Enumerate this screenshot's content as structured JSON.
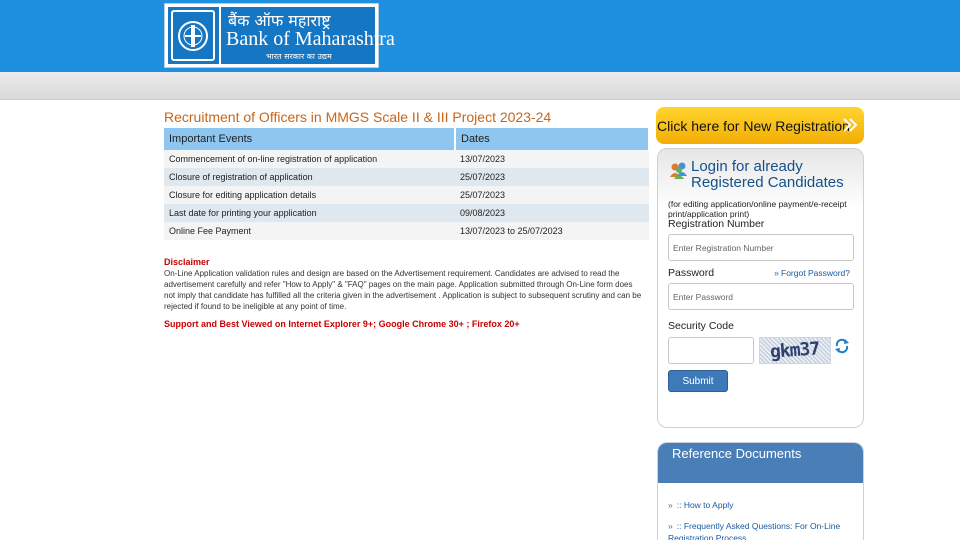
{
  "header": {
    "logo_hindi": "बैंक ऑफ महाराष्ट्र",
    "logo_english": "Bank of Maharashtra",
    "logo_tagline": "भारत सरकार का उद्यम",
    "brand_color": "#1f90e0"
  },
  "main": {
    "title": "Recruitment of Officers in MMGS Scale II & III Project 2023-24",
    "table": {
      "headers": [
        "Important Events",
        "Dates"
      ],
      "rows": [
        [
          "Commencement of on-line registration of application",
          "13/07/2023"
        ],
        [
          "Closure of registration of application",
          "25/07/2023"
        ],
        [
          "Closure for editing application details",
          "25/07/2023"
        ],
        [
          "Last date for printing your application",
          "09/08/2023"
        ],
        [
          "Online Fee Payment",
          "13/07/2023 to 25/07/2023"
        ]
      ]
    },
    "disclaimer_title": "Disclaimer",
    "disclaimer_text": "On-Line Application validation rules and design are based on the Advertisement requirement. Candidates are advised to read the advertisement carefully and refer \"How to Apply\" & \"FAQ\" pages on the main page. Application submitted through On-Line form does not imply that candidate has fulfilled all the criteria given in the advertisement . Application is subject to subsequent scrutiny and can be rejected if found to be ineligible at any point of time.",
    "support_text": "Support and Best Viewed on Internet Explorer 9+; Google Chrome 30+ ; Firefox 20+"
  },
  "sidebar": {
    "new_registration_label": "Click here for New Registration",
    "login": {
      "title": "Login for already Registered Candidates",
      "note": "(for editing application/online payment/e-receipt print/application print)",
      "reg_label": "Registration Number",
      "reg_placeholder": "Enter Registration Number",
      "password_label": "Password",
      "password_placeholder": "Enter Password",
      "forgot_label": "Forgot Password?",
      "security_label": "Security Code",
      "captcha_text": "gkm37",
      "submit_label": "Submit"
    },
    "reference": {
      "title": "Reference Documents",
      "items": [
        ":: How to Apply",
        ":: Frequently Asked Questions: For On-Line Registration Process"
      ]
    }
  }
}
